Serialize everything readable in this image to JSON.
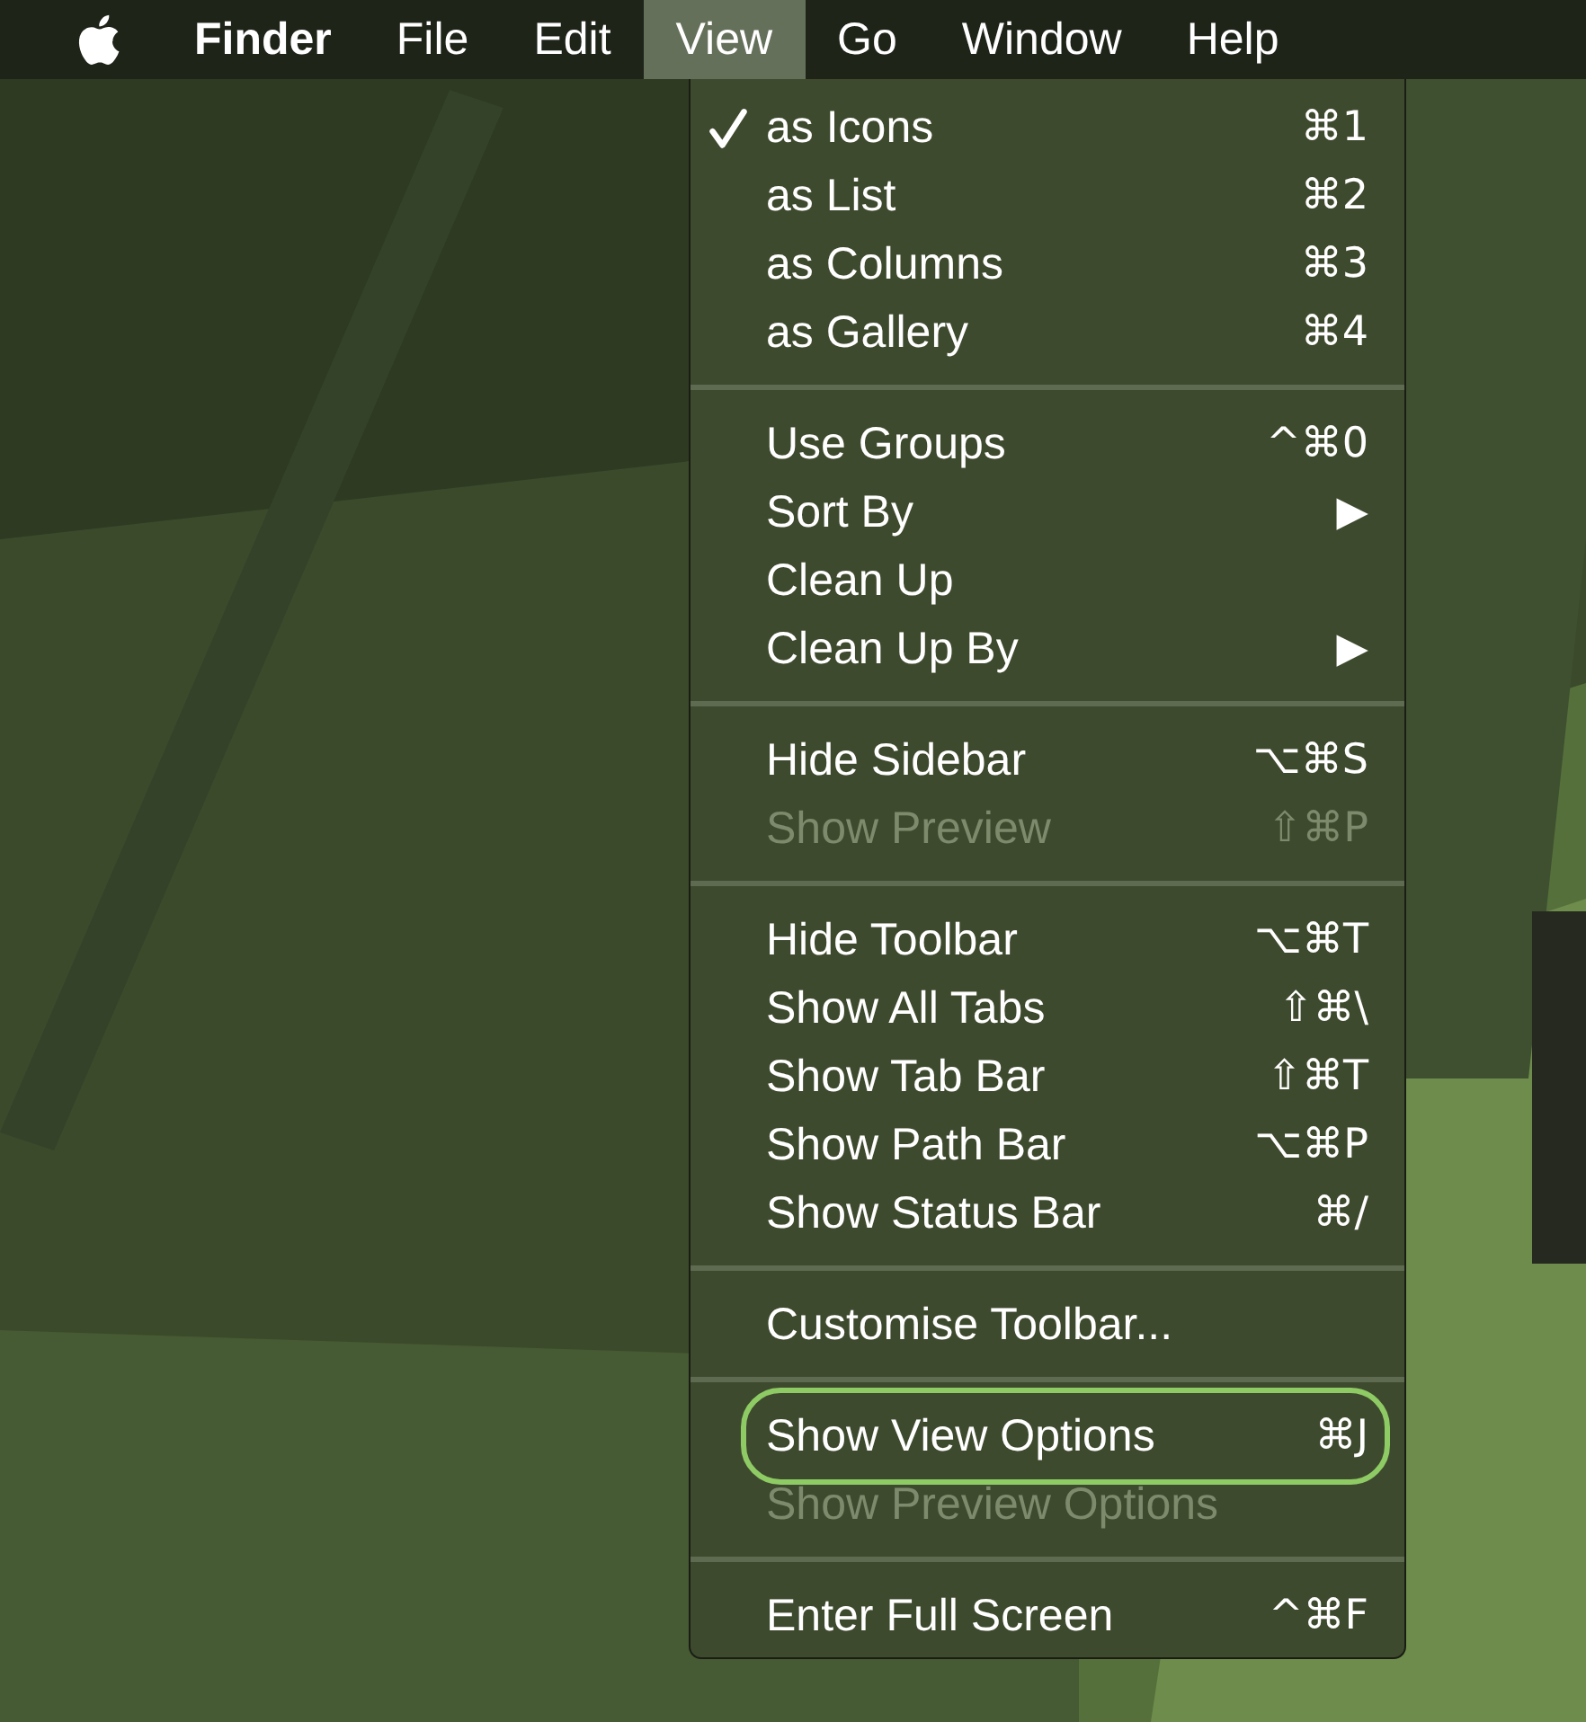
{
  "menubar": {
    "items": [
      {
        "label": "Finder",
        "kind": "app",
        "selected": false
      },
      {
        "label": "File",
        "kind": "menu",
        "selected": false
      },
      {
        "label": "Edit",
        "kind": "menu",
        "selected": false
      },
      {
        "label": "View",
        "kind": "menu",
        "selected": true
      },
      {
        "label": "Go",
        "kind": "menu",
        "selected": false
      },
      {
        "label": "Window",
        "kind": "menu",
        "selected": false
      },
      {
        "label": "Help",
        "kind": "menu",
        "selected": false
      }
    ]
  },
  "view_menu": {
    "groups": [
      {
        "items": [
          {
            "label": "as Icons",
            "shortcut": "⌘1",
            "checked": true,
            "disabled": false,
            "highlighted": false
          },
          {
            "label": "as List",
            "shortcut": "⌘2",
            "checked": false,
            "disabled": false,
            "highlighted": false
          },
          {
            "label": "as Columns",
            "shortcut": "⌘3",
            "checked": false,
            "disabled": false,
            "highlighted": false
          },
          {
            "label": "as Gallery",
            "shortcut": "⌘4",
            "checked": false,
            "disabled": false,
            "highlighted": false
          }
        ]
      },
      {
        "items": [
          {
            "label": "Use Groups",
            "shortcut": "^⌘0",
            "checked": false,
            "disabled": false,
            "highlighted": false
          },
          {
            "label": "Sort By",
            "shortcut": "▶",
            "checked": false,
            "disabled": false,
            "highlighted": false
          },
          {
            "label": "Clean Up",
            "checked": false,
            "disabled": false,
            "highlighted": false
          },
          {
            "label": "Clean Up By",
            "shortcut": "▶",
            "checked": false,
            "disabled": false,
            "highlighted": false
          }
        ]
      },
      {
        "items": [
          {
            "label": "Hide Sidebar",
            "shortcut": "⌥⌘S",
            "checked": false,
            "disabled": false,
            "highlighted": false
          },
          {
            "label": "Show Preview",
            "shortcut": "⇧⌘P",
            "checked": false,
            "disabled": true,
            "highlighted": false
          }
        ]
      },
      {
        "items": [
          {
            "label": "Hide Toolbar",
            "shortcut": "⌥⌘T",
            "checked": false,
            "disabled": false,
            "highlighted": false
          },
          {
            "label": "Show All Tabs",
            "shortcut": "⇧⌘\\",
            "checked": false,
            "disabled": false,
            "highlighted": false
          },
          {
            "label": "Show Tab Bar",
            "shortcut": "⇧⌘T",
            "checked": false,
            "disabled": false,
            "highlighted": false
          },
          {
            "label": "Show Path Bar",
            "shortcut": "⌥⌘P",
            "checked": false,
            "disabled": false,
            "highlighted": false
          },
          {
            "label": "Show Status Bar",
            "shortcut": "⌘/",
            "checked": false,
            "disabled": false,
            "highlighted": false
          }
        ]
      },
      {
        "items": [
          {
            "label": "Customise Toolbar...",
            "checked": false,
            "disabled": false,
            "highlighted": false
          }
        ]
      },
      {
        "items": [
          {
            "label": "Show View Options",
            "shortcut": "⌘J",
            "checked": false,
            "disabled": false,
            "highlighted": true
          },
          {
            "label": "Show Preview Options",
            "checked": false,
            "disabled": true,
            "highlighted": false
          }
        ]
      },
      {
        "items": [
          {
            "label": "Enter Full Screen",
            "shortcut": "^⌘F",
            "checked": false,
            "disabled": false,
            "highlighted": false
          }
        ]
      }
    ]
  }
}
